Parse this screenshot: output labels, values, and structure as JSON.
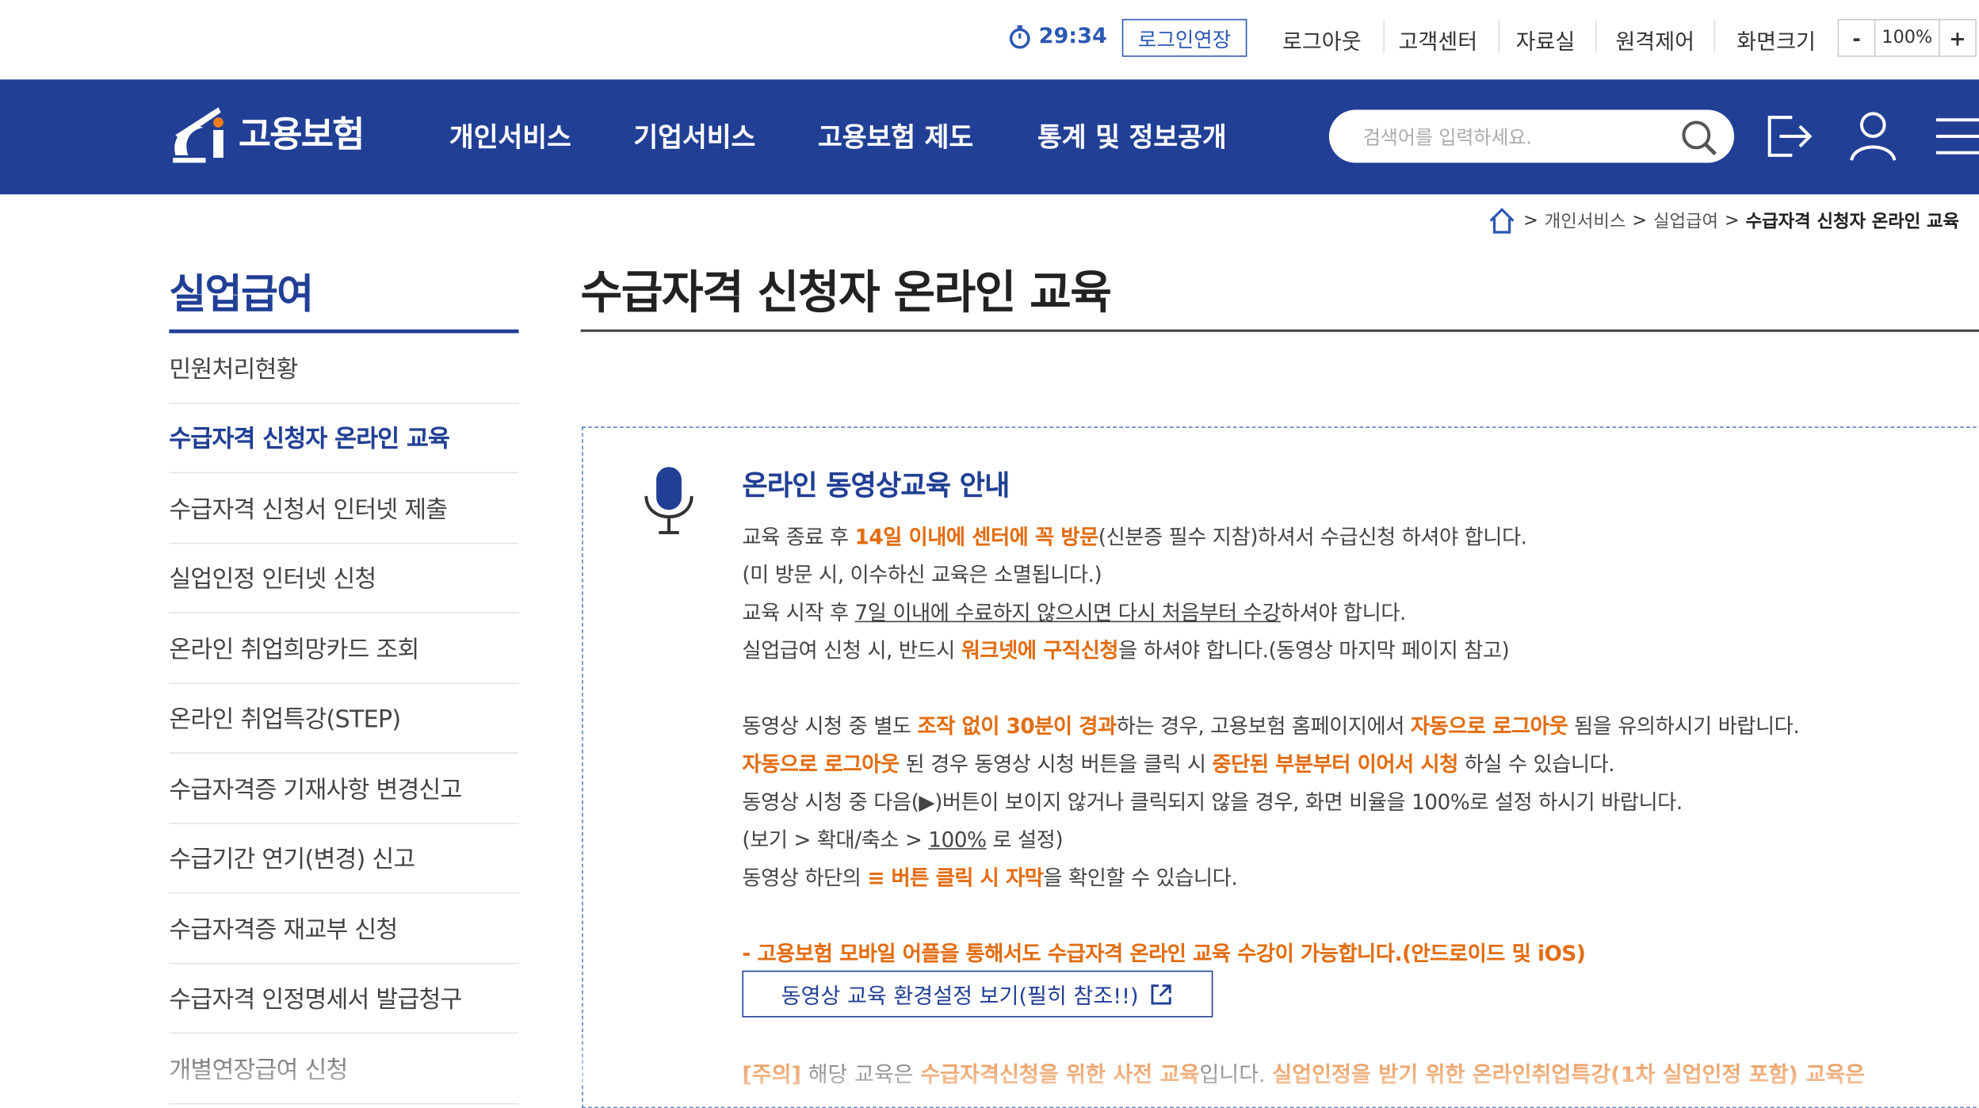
{
  "utility": {
    "timer": "29:34",
    "extend_login": "로그인연장",
    "logout": "로그아웃",
    "customer_center": "고객센터",
    "archive": "자료실",
    "remote_control": "원격제어",
    "screen_size": "화면크기",
    "zoom_minus": "-",
    "zoom_value": "100%",
    "zoom_plus": "+"
  },
  "nav": {
    "logo_text": "고용보험",
    "menu": [
      "개인서비스",
      "기업서비스",
      "고용보험 제도",
      "통계 및 정보공개"
    ],
    "search_placeholder": "검색어를 입력하세요."
  },
  "breadcrumb": [
    "개인서비스",
    "실업급여",
    "수급자격 신청자 온라인 교육"
  ],
  "sidebar": {
    "title": "실업급여",
    "items": [
      "민원처리현황",
      "수급자격 신청자 온라인 교육",
      "수급자격 신청서 인터넷 제출",
      "실업인정 인터넷 신청",
      "온라인 취업희망카드 조회",
      "온라인 취업특강(STEP)",
      "수급자격증 기재사항 변경신고",
      "수급기간 연기(변경) 신고",
      "수급자격증 재교부 신청",
      "수급자격 인정명세서 발급청구",
      "개별연장급여 신청"
    ],
    "active_index": 1
  },
  "main": {
    "page_title": "수급자격 신청자 온라인 교육",
    "info_title": "온라인 동영상교육 안내",
    "l1a": "교육 종료 후 ",
    "l1b": "14일 이내에 센터에 꼭 방문",
    "l1c": "(신분증 필수 지참)하셔서 수급신청 하셔야 합니다.",
    "l2": "(미 방문 시, 이수하신 교육은 소멸됩니다.)",
    "l3a": "교육 시작 후 ",
    "l3b": "7일 이내에 수료하지 않으시면 다시 처음부터 수강",
    "l3c": "하셔야 합니다.",
    "l4a": "실업급여 신청 시, 반드시 ",
    "l4b": "워크넷에 구직신청",
    "l4c": "을 하셔야 합니다.(동영상 마지막 페이지 참고)",
    "l5a": "동영상 시청 중 별도 ",
    "l5b": "조작 없이 30분이 경과",
    "l5c": "하는 경우, 고용보험 홈페이지에서 ",
    "l5d": "자동으로 로그아웃",
    "l5e": " 됨을 유의하시기 바랍니다.",
    "l6a": "자동으로 로그아웃",
    "l6b": " 된 경우 동영상 시청 버튼을 클릭 시 ",
    "l6c": "중단된 부분부터 이어서 시청",
    "l6d": " 하실 수 있습니다.",
    "l7": "동영상 시청 중 다음(▶)버튼이 보이지 않거나 클릭되지 않을 경우, 화면 비율을 100%로 설정 하시기 바랍니다.",
    "l8a": "(보기 > 확대/축소 > ",
    "l8b": "100%",
    "l8c": " 로 설정)",
    "l9a": "동영상 하단의 ",
    "l9b": "≡ 버튼 클릭 시 자막",
    "l9c": "을 확인할 수 있습니다.",
    "mobile_notice": "- 고용보험 모바일 어플을 통해서도 수급자격 온라인 교육 수강이 가능합니다.(안드로이드 및 iOS)",
    "env_button": "동영상 교육 환경설정 보기(필히 참조!!)",
    "caution_label": "[주의]",
    "caution_a": " 해당 교육은 ",
    "caution_b": "수급자격신청을 위한 사전 교육",
    "caution_c": "입니다. ",
    "caution_d": "실업인정을 받기 위한 온라인취업특강(1차 실업인정 포함) 교육은"
  },
  "colors": {
    "nav_bg": "#213f95",
    "accent_orange": "#e36d12",
    "link_blue": "#2b58b3"
  }
}
